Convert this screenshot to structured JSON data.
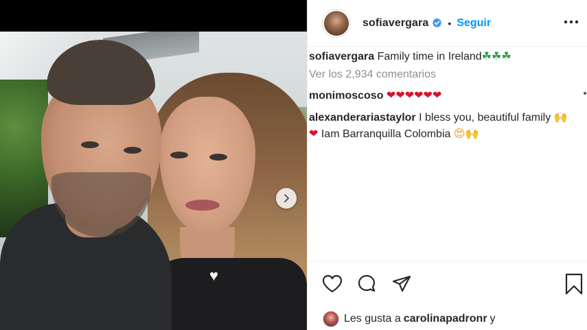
{
  "post": {
    "username": "sofiavergara",
    "follow_label": "Seguir",
    "separator": "•"
  },
  "caption": {
    "username": "sofiavergara",
    "text": "Family time in Ireland",
    "emoji": "☘☘☘"
  },
  "view_comments": "Ver los 2,934 comentarios",
  "comments": [
    {
      "username": "monimoscoso",
      "text": "",
      "emoji": "❤❤❤❤❤❤"
    },
    {
      "username": "alexanderariastaylor",
      "text": "I bless you, beautiful family",
      "emoji_end": "🙌",
      "line2_emoji_start": "❤",
      "line2_text": "Iam Barranquilla Colombia",
      "line2_emoji_end": "😍🙌"
    }
  ],
  "likes": {
    "prefix": "Les gusta a",
    "user": "carolinapadronr",
    "suffix": "y"
  },
  "icons": {
    "verified": "verified-badge-icon",
    "more": "more-options-icon",
    "next": "chevron-right-icon",
    "like": "heart-outline-icon",
    "comment": "comment-bubble-icon",
    "share": "paper-plane-icon",
    "save": "bookmark-icon"
  },
  "colors": {
    "accent": "#0095f6",
    "text": "#262626",
    "secondary_text": "#8e8e8e",
    "heart": "#d6132b"
  }
}
